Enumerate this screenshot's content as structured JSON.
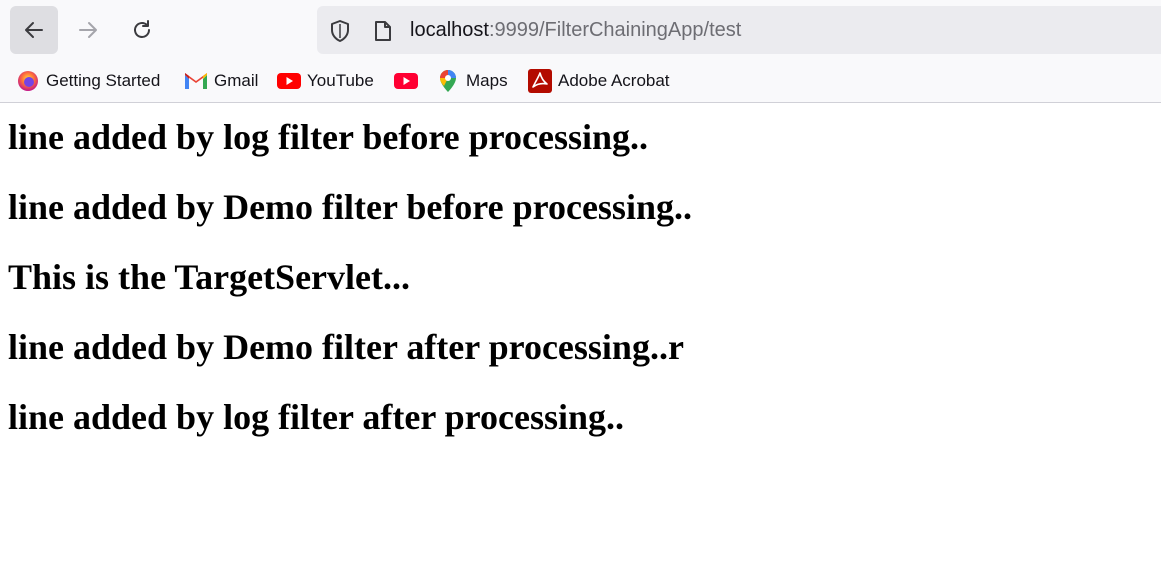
{
  "browser": {
    "url_host": "localhost",
    "url_rest": ":9999/FilterChainingApp/test"
  },
  "bookmarks": [
    {
      "label": "Getting Started",
      "icon": "firefox-icon"
    },
    {
      "label": "Gmail",
      "icon": "gmail-icon"
    },
    {
      "label": "YouTube",
      "icon": "youtube-icon"
    },
    {
      "label": "",
      "icon": "youtube-icon"
    },
    {
      "label": "Maps",
      "icon": "maps-pin-icon"
    },
    {
      "label": "Adobe Acrobat",
      "icon": "acrobat-icon"
    }
  ],
  "content": {
    "lines": [
      "line added by log filter before processing..",
      "line added by Demo filter before processing..",
      "This is the TargetServlet...",
      "line added by Demo filter after processing..r",
      "line added by log filter after processing.."
    ]
  },
  "colors": {
    "youtube_red": "#ff0000",
    "acrobat_red": "#b30b00",
    "toolbar_bg": "#f9f9fb",
    "urlbar_bg": "#ebebef"
  }
}
